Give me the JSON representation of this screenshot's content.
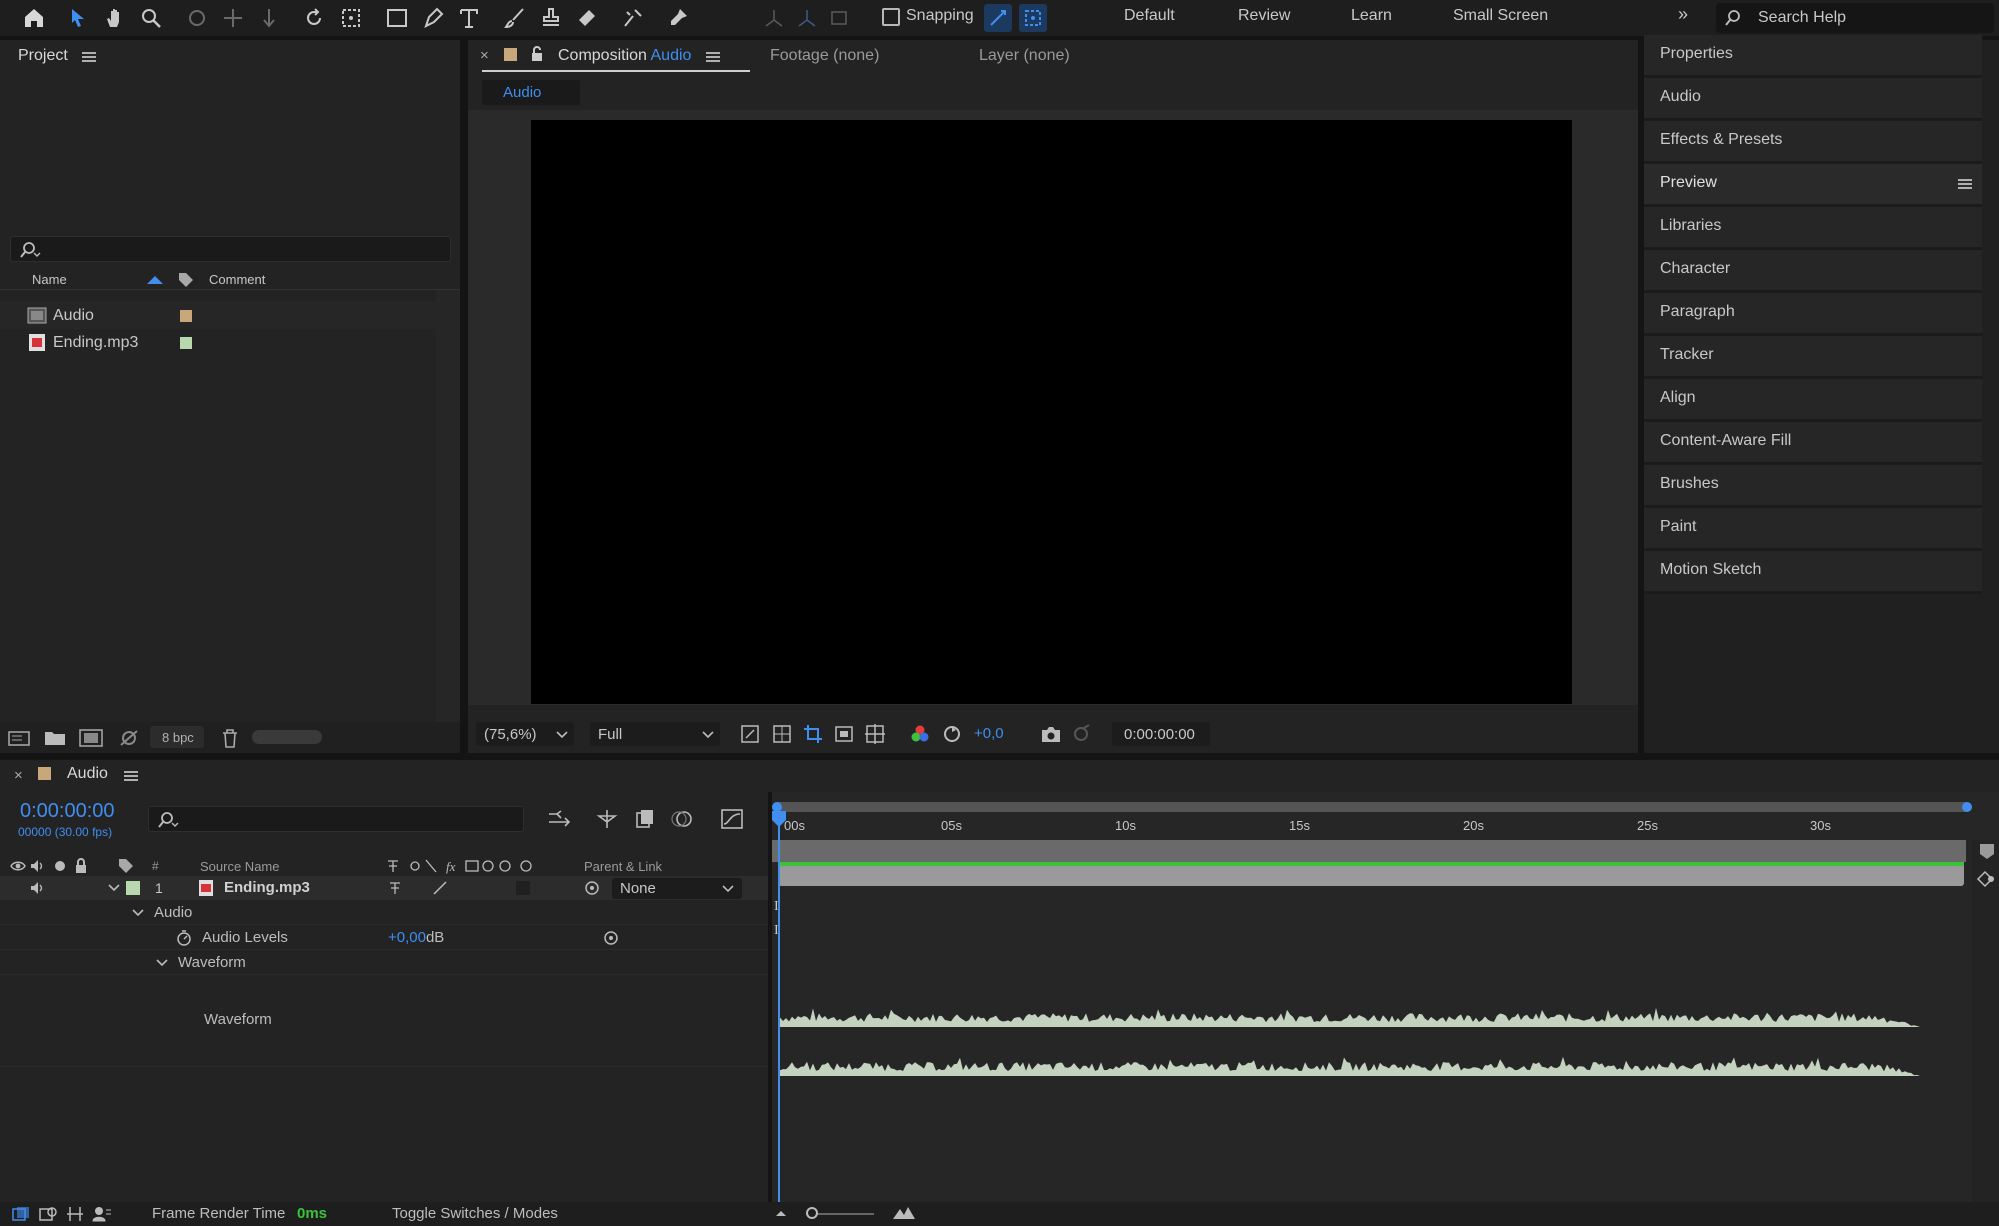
{
  "toolbar": {
    "snapping_label": "Snapping",
    "workspaces": [
      "Default",
      "Review",
      "Learn",
      "Small Screen"
    ],
    "search_placeholder": "Search Help"
  },
  "project": {
    "title": "Project",
    "columns": {
      "name": "Name",
      "comment": "Comment"
    },
    "items": [
      {
        "name": "Audio",
        "type": "composition",
        "label_color": "#c8a87a"
      },
      {
        "name": "Ending.mp3",
        "type": "audio",
        "label_color": "#b8d8b0"
      }
    ],
    "bpc": "8 bpc"
  },
  "viewer": {
    "tab_title_prefix": "Composition",
    "tab_title_name": "Audio",
    "footage_tab": "Footage (none)",
    "layer_tab": "Layer (none)",
    "comp_crumb": "Audio",
    "zoom": "(75,6%)",
    "resolution": "Full",
    "exposure": "+0,0",
    "timecode": "0:00:00:00"
  },
  "right_panels": [
    "Properties",
    "Audio",
    "Effects & Presets",
    "Preview",
    "Libraries",
    "Character",
    "Paragraph",
    "Tracker",
    "Align",
    "Content-Aware Fill",
    "Brushes",
    "Paint",
    "Motion Sketch"
  ],
  "timeline": {
    "title": "Audio",
    "timecode": "0:00:00:00",
    "frames": "00000 (30.00 fps)",
    "col_number": "#",
    "col_source": "Source Name",
    "col_parent": "Parent & Link",
    "layer_number": "1",
    "layer_name": "Ending.mp3",
    "parent_value": "None",
    "audio_group": "Audio",
    "audio_levels_label": "Audio Levels",
    "audio_levels_value": "+0,00",
    "audio_levels_unit": "dB",
    "waveform_group": "Waveform",
    "waveform_label": "Waveform",
    "ruler_ticks": [
      "00s",
      "05s",
      "10s",
      "15s",
      "20s",
      "25s",
      "30s"
    ],
    "frame_render_label": "Frame Render Time",
    "frame_render_value": "0ms",
    "toggle_label": "Toggle Switches / Modes"
  },
  "colors": {
    "accent": "#3f8ef0",
    "waveform": "#c3d3bf",
    "track_green": "#3bc23b"
  }
}
